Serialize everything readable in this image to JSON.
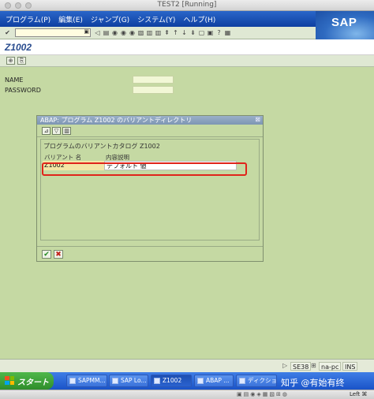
{
  "window": {
    "title": "TEST2 [Running]"
  },
  "menubar": {
    "items": [
      "プログラム(P)",
      "編集(E)",
      "ジャンプ(G)",
      "システム(Y)",
      "ヘルプ(H)"
    ]
  },
  "sap_logo": "SAP",
  "title_area": {
    "program": "Z1002"
  },
  "fields": [
    {
      "label": "NAME",
      "value": ""
    },
    {
      "label": "PASSWORD",
      "value": ""
    }
  ],
  "dialog": {
    "title": "ABAP: プログラム Z1002 のバリアントディレクトリ",
    "catalog_caption": "プログラムのバリアントカタログ Z1002",
    "columns": [
      "バリアント 名",
      "内容説明"
    ],
    "rows": [
      {
        "variant": "Z1002",
        "description": "デフォルト 値"
      }
    ]
  },
  "statusbar": {
    "transaction": "SE38",
    "server": "na-pc",
    "mode": "INS"
  },
  "taskbar": {
    "start": "スタート",
    "tasks": [
      "SAPMM...",
      "SAP Lo...",
      "Z1002",
      "ABAP ...",
      "ディクショ..."
    ],
    "watermark": "知乎 @有始有终"
  },
  "host": {
    "key_label": "Left ⌘"
  },
  "colors": {
    "menubar": "#1a4fb0",
    "content": "#c5d9a3",
    "highlight": "#e0241b",
    "dialog_title": "#8aa2c0"
  }
}
